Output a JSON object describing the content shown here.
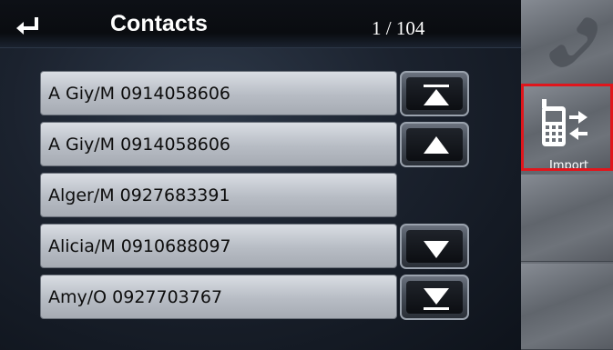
{
  "header": {
    "title": "Contacts",
    "counter": "1 / 104"
  },
  "contacts": [
    {
      "label": "A Giy/M  0914058606"
    },
    {
      "label": "A Giy/M  0914058606"
    },
    {
      "label": "Alger/M  0927683391"
    },
    {
      "label": "Alicia/M  0910688097"
    },
    {
      "label": "Amy/O  0927703767"
    }
  ],
  "scroll_buttons": [
    {
      "icon": "scroll-to-top-icon"
    },
    {
      "icon": "scroll-up-icon"
    },
    {
      "icon": "scroll-down-icon"
    },
    {
      "icon": "scroll-to-bottom-icon"
    }
  ],
  "side_panel": {
    "call_icon": "phone-icon",
    "import_label": "Import",
    "import_icon": "phone-transfer-icon",
    "highlight_color": "#e0161c"
  }
}
